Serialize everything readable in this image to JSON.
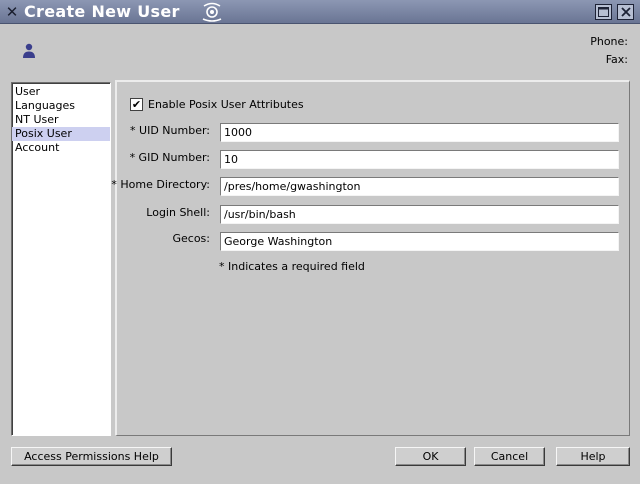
{
  "window": {
    "title": "Create New User",
    "app_icon": "x-icon",
    "logo_icon": "swirl-logo-icon"
  },
  "header": {
    "user_icon": "person-icon",
    "phone_label": "Phone:",
    "fax_label": "Fax:"
  },
  "nav": {
    "items": [
      {
        "label": "User"
      },
      {
        "label": "Languages"
      },
      {
        "label": "NT User"
      },
      {
        "label": "Posix User",
        "selected": true
      },
      {
        "label": "Account"
      }
    ]
  },
  "posix": {
    "enable_label": "Enable Posix User Attributes",
    "enable_checked": true,
    "check_mark": "✔",
    "fields": [
      {
        "label": "* UID Number:",
        "value": "1000"
      },
      {
        "label": "* GID Number:",
        "value": "10"
      },
      {
        "label": "* Home Directory:",
        "value": "/pres/home/gwashington"
      },
      {
        "label": "Login Shell:",
        "value": "/usr/bin/bash"
      },
      {
        "label": "Gecos:",
        "value": "George Washington"
      }
    ],
    "required_note": "* Indicates a required field"
  },
  "buttons": {
    "access_help": "Access Permissions Help",
    "ok": "OK",
    "cancel": "Cancel",
    "help": "Help"
  },
  "colors": {
    "titlebar": "#7a84a3",
    "background": "#c8c8c8",
    "nav_selected": "#cdd0f0"
  }
}
